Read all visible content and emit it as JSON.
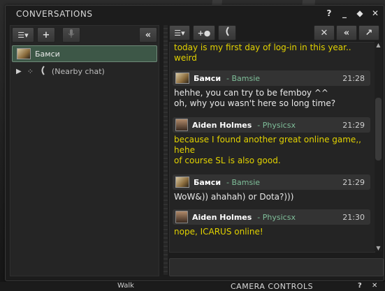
{
  "window": {
    "title": "CONVERSATIONS",
    "buttons": [
      "?",
      "_",
      "◆",
      "✕"
    ]
  },
  "left_toolbar": {
    "menu_icon": "menu-icon",
    "add_label": "+",
    "mic_icon": "microphone-icon",
    "collapse_label": "«"
  },
  "conversations": [
    {
      "name": "Бамси",
      "selected": true
    },
    {
      "name": "(Nearby chat)",
      "selected": false
    }
  ],
  "right_toolbar": {
    "menu_icon": "menu-icon",
    "add_person_icon": "add-person-icon",
    "call_icon": "phone-icon",
    "close_label": "✕",
    "collapse_label": "«",
    "expand_icon": "arrow-up-right-icon"
  },
  "chat": {
    "intro_lines": [
      "today is my first day of log-in in this year..",
      "weird"
    ],
    "messages": [
      {
        "name": "Бамси",
        "username": "- Bamsie",
        "time": "21:28",
        "lines": [
          "hehhe, you can try to be femboy ^^",
          "oh, why you wasn't here so long time?"
        ]
      },
      {
        "name": "Aiden Holmes",
        "username": "- Physicsx",
        "time": "21:29",
        "lines": [
          "because I found another great online game,, hehe",
          "of course SL is also good."
        ]
      },
      {
        "name": "Бамси",
        "username": "- Bamsie",
        "time": "21:29",
        "lines": [
          "WoW&)) ahahah) or Dota?)))"
        ]
      },
      {
        "name": "Aiden Holmes",
        "username": "- Physicsx",
        "time": "21:30",
        "lines": [
          "nope, ICARUS online!"
        ]
      }
    ]
  },
  "bottom": {
    "walk_label": "Walk",
    "camera_label": "CAMERA CONTROLS",
    "help": "?",
    "close": "✕"
  },
  "colors": {
    "self_text": "#e2d200",
    "other_text": "#e8e8e8",
    "username": "#7fbf9a",
    "selected_row": "#3d5747"
  }
}
